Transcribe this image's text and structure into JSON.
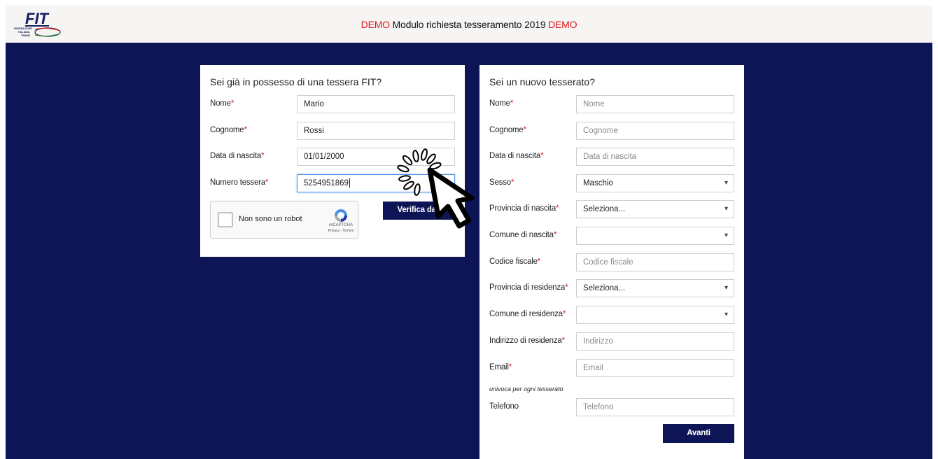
{
  "header": {
    "logo_text": "FIT",
    "logo_subtext": "FEDERAZIONE ITALIANA TENNIS",
    "title_prefix": "DEMO",
    "title_main": " Modulo richiesta tesseramento 2019 ",
    "title_suffix": "DEMO"
  },
  "existing_member": {
    "heading": "Sei già in possesso di una tessera FIT?",
    "fields": [
      {
        "label": "Nome",
        "required": "*",
        "value": "Mario"
      },
      {
        "label": "Cognome",
        "required": "*",
        "value": "Rossi"
      },
      {
        "label": "Data di nascita",
        "required": "*",
        "value": "01/01/2000"
      },
      {
        "label": "Numero tessera",
        "required": "*",
        "value": "5254951869"
      }
    ],
    "captcha_label": "Non sono un robot",
    "captcha_brand": "reCAPTCHA",
    "captcha_links": "Privacy - Termini",
    "verify_button": "Verifica dati"
  },
  "new_member": {
    "heading": "Sei un nuovo tesserato?",
    "fields": [
      {
        "label": "Nome",
        "required": "*",
        "placeholder": "Nome"
      },
      {
        "label": "Cognome",
        "required": "*",
        "placeholder": "Cognome"
      },
      {
        "label": "Data di nascita",
        "required": "*",
        "placeholder": "Data di nascita"
      },
      {
        "label": "Sesso",
        "required": "*",
        "value": "Maschio"
      },
      {
        "label": "Provincia di nascita",
        "required": "*",
        "value": "Seleziona..."
      },
      {
        "label": "Comune di nascita",
        "required": "*",
        "value": ""
      },
      {
        "label": "Codice fiscale",
        "required": "*",
        "placeholder": "Codice fiscale"
      },
      {
        "label": "Provincia di residenza",
        "required": "*",
        "value": "Seleziona..."
      },
      {
        "label": "Comune di residenza",
        "required": "*",
        "value": ""
      },
      {
        "label": "Indirizzo di residenza",
        "required": "*",
        "placeholder": "Indirizzo"
      },
      {
        "label": "Email",
        "required": "*",
        "placeholder": "Email",
        "note": "univoca per ogni tesserato"
      },
      {
        "label": "Telefono",
        "required": "",
        "placeholder": "Telefono"
      }
    ],
    "next_button": "Avanti"
  },
  "colors": {
    "navy": "#0e1556",
    "red": "#e0151b",
    "header_bg": "#f7f4f4"
  },
  "icons": {
    "cursor": "hand-pointer-click-icon",
    "captcha": "recaptcha-icon"
  }
}
